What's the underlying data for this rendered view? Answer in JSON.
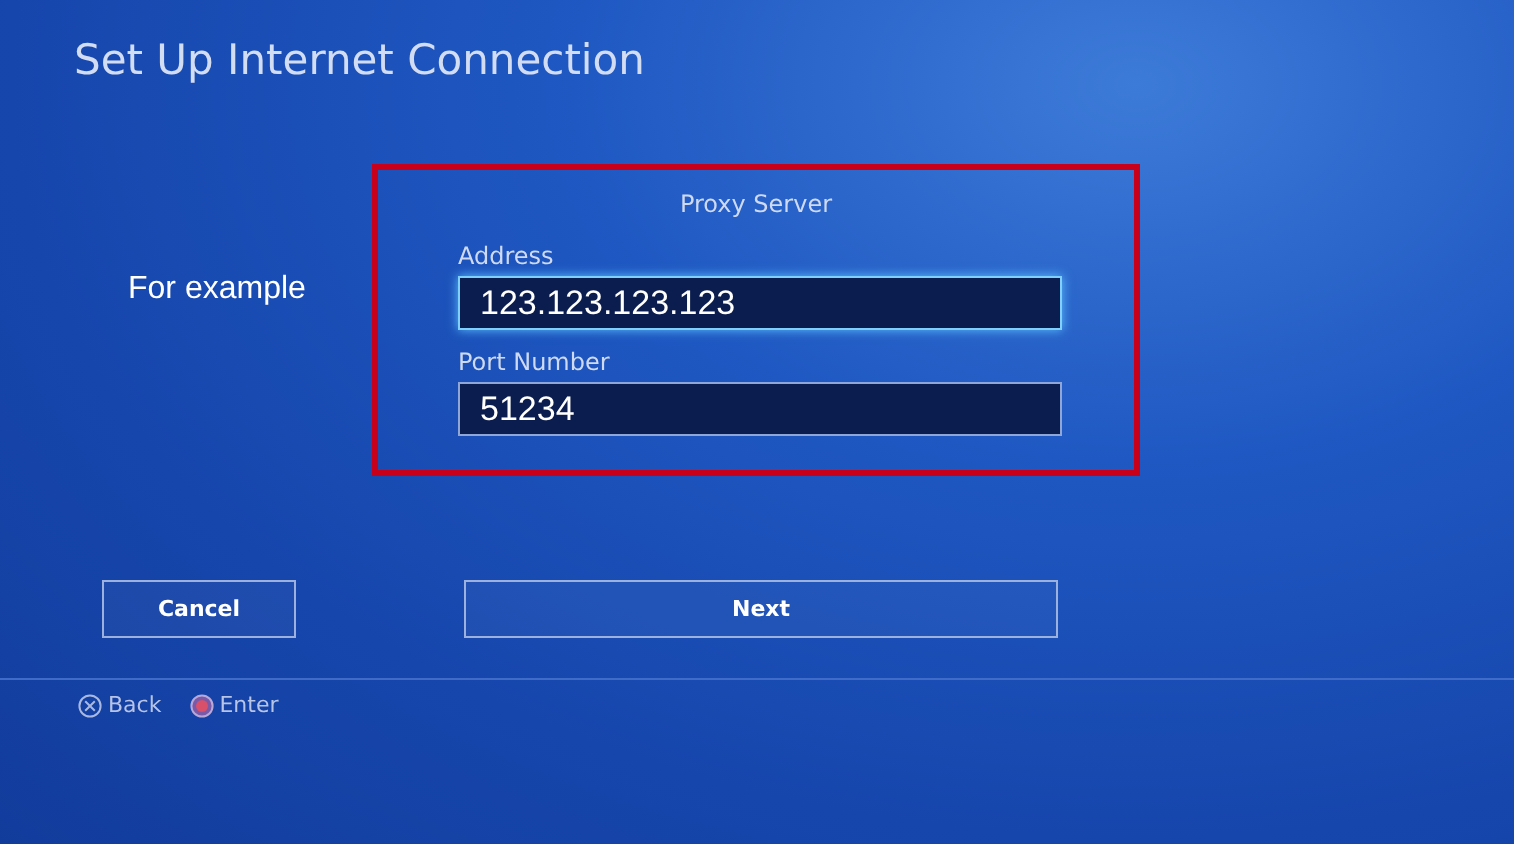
{
  "window": {
    "title": "Set Up Internet Connection"
  },
  "annotation": "For example",
  "panel": {
    "title": "Proxy Server",
    "fields": [
      {
        "label": "Address",
        "value": "123.123.123.123",
        "focused": true
      },
      {
        "label": "Port Number",
        "value": "51234",
        "focused": false
      }
    ]
  },
  "buttons": [
    {
      "label": "Cancel",
      "kind": "secondary"
    },
    {
      "label": "Next",
      "kind": "primary"
    }
  ],
  "hints": [
    {
      "label": "Back",
      "kind": "cross"
    },
    {
      "label": "Enter",
      "kind": "circle"
    }
  ]
}
